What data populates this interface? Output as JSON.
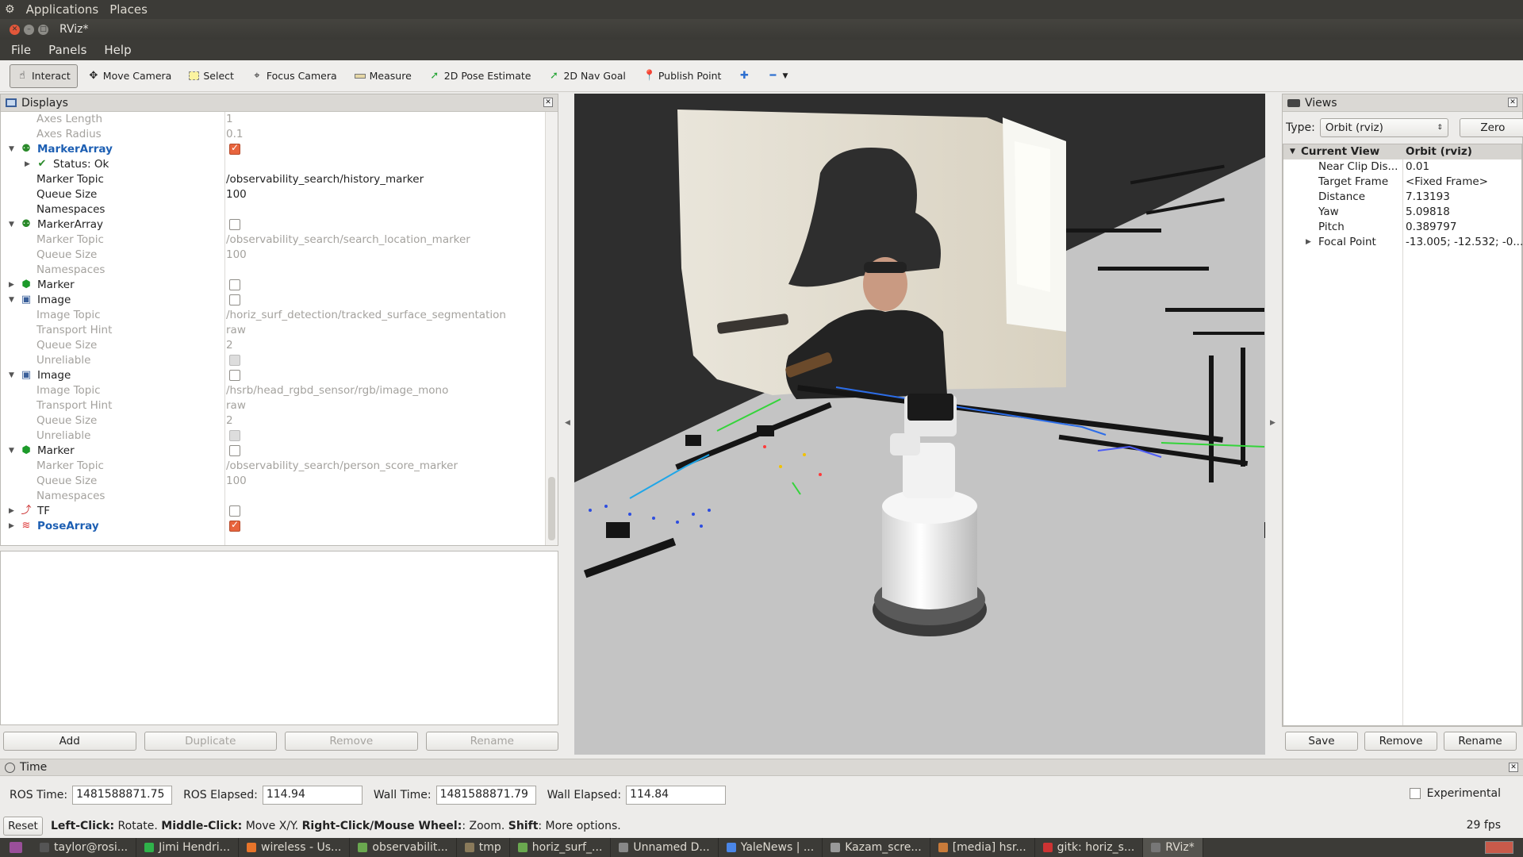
{
  "system_bar": {
    "applications": "Applications",
    "places": "Places"
  },
  "window": {
    "title": "RViz*"
  },
  "menu": [
    "File",
    "Panels",
    "Help"
  ],
  "toolbar": [
    {
      "label": "Interact",
      "icon": "cursor-icon",
      "active": true
    },
    {
      "label": "Move Camera",
      "icon": "move-camera-icon"
    },
    {
      "label": "Select",
      "icon": "select-icon"
    },
    {
      "label": "Focus Camera",
      "icon": "focus-camera-icon"
    },
    {
      "label": "Measure",
      "icon": "ruler-icon"
    },
    {
      "label": "2D Pose Estimate",
      "icon": "pose-estimate-icon"
    },
    {
      "label": "2D Nav Goal",
      "icon": "nav-goal-icon"
    },
    {
      "label": "Publish Point",
      "icon": "map-pin-icon"
    }
  ],
  "displays": {
    "title": "Displays",
    "rows": [
      {
        "name": "Axes Length",
        "value": "1",
        "disabled": true
      },
      {
        "name": "Axes Radius",
        "value": "0.1",
        "disabled": true
      },
      {
        "name": "MarkerArray",
        "group": true,
        "expanded": true,
        "highlight": true,
        "icon": "marker-array-icon",
        "checked": true
      },
      {
        "name": "Status: Ok",
        "status": true,
        "collapsed": true
      },
      {
        "name": "Marker Topic",
        "value": "/observability_search/history_marker"
      },
      {
        "name": "Queue Size",
        "value": "100"
      },
      {
        "name": "Namespaces",
        "value": ""
      },
      {
        "name": "MarkerArray",
        "group": true,
        "expanded": true,
        "icon": "marker-array-icon",
        "checked": false
      },
      {
        "name": "Marker Topic",
        "value": "/observability_search/search_location_marker",
        "disabled": true
      },
      {
        "name": "Queue Size",
        "value": "100",
        "disabled": true
      },
      {
        "name": "Namespaces",
        "value": "",
        "disabled": true
      },
      {
        "name": "Marker",
        "group": true,
        "expanded": false,
        "icon": "marker-cube-icon",
        "checked": false
      },
      {
        "name": "Image",
        "group": true,
        "expanded": true,
        "icon": "image-icon",
        "checked": false
      },
      {
        "name": "Image Topic",
        "value": "/horiz_surf_detection/tracked_surface_segmentation",
        "disabled": true
      },
      {
        "name": "Transport Hint",
        "value": "raw",
        "disabled": true
      },
      {
        "name": "Queue Size",
        "value": "2",
        "disabled": true
      },
      {
        "name": "Unreliable",
        "value": "",
        "disabled": true,
        "greybox": true
      },
      {
        "name": "Image",
        "group": true,
        "expanded": true,
        "icon": "image-icon",
        "checked": false
      },
      {
        "name": "Image Topic",
        "value": "/hsrb/head_rgbd_sensor/rgb/image_mono",
        "disabled": true
      },
      {
        "name": "Transport Hint",
        "value": "raw",
        "disabled": true
      },
      {
        "name": "Queue Size",
        "value": "2",
        "disabled": true
      },
      {
        "name": "Unreliable",
        "value": "",
        "disabled": true,
        "greybox": true
      },
      {
        "name": "Marker",
        "group": true,
        "expanded": true,
        "icon": "marker-cube-icon",
        "checked": false
      },
      {
        "name": "Marker Topic",
        "value": "/observability_search/person_score_marker",
        "disabled": true
      },
      {
        "name": "Queue Size",
        "value": "100",
        "disabled": true
      },
      {
        "name": "Namespaces",
        "value": "",
        "disabled": true
      },
      {
        "name": "TF",
        "group": true,
        "expanded": false,
        "icon": "tf-icon",
        "checked": false
      },
      {
        "name": "PoseArray",
        "group": true,
        "expanded": false,
        "highlight": true,
        "icon": "pose-array-icon",
        "checked": true
      }
    ],
    "buttons": [
      "Add",
      "Duplicate",
      "Remove",
      "Rename"
    ]
  },
  "views": {
    "title": "Views",
    "type_label": "Type:",
    "type_value": "Orbit (rviz)",
    "zero": "Zero",
    "header": {
      "key": "Current View",
      "value": "Orbit (rviz)"
    },
    "rows": [
      {
        "k": "Near Clip Dis...",
        "v": "0.01"
      },
      {
        "k": "Target Frame",
        "v": "<Fixed Frame>"
      },
      {
        "k": "Distance",
        "v": "7.13193"
      },
      {
        "k": "Yaw",
        "v": "5.09818"
      },
      {
        "k": "Pitch",
        "v": "0.389797"
      },
      {
        "k": "Focal Point",
        "v": "-13.005; -12.532; -0....",
        "expandable": true
      }
    ],
    "buttons": [
      "Save",
      "Remove",
      "Rename"
    ]
  },
  "time": {
    "title": "Time",
    "ros_time_label": "ROS Time:",
    "ros_time": "1481588871.75",
    "ros_elapsed_label": "ROS Elapsed:",
    "ros_elapsed": "114.94",
    "wall_time_label": "Wall Time:",
    "wall_time": "1481588871.79",
    "wall_elapsed_label": "Wall Elapsed:",
    "wall_elapsed": "114.84",
    "experimental": "Experimental"
  },
  "status": {
    "reset": "Reset",
    "left_click": "Left-Click:",
    "left_click_text": " Rotate. ",
    "middle_click": "Middle-Click:",
    "middle_click_text": " Move X/Y. ",
    "right_click": "Right-Click/Mouse Wheel:",
    "right_click_text": ": Zoom. ",
    "shift": "Shift",
    "shift_text": ": More options.",
    "fps": "29 fps"
  },
  "taskbar": [
    {
      "label": "taylor@rosi...",
      "color": "#555"
    },
    {
      "label": "Jimi Hendri...",
      "color": "#2fb24a"
    },
    {
      "label": "wireless - Us...",
      "color": "#e8742a"
    },
    {
      "label": "observabilit...",
      "color": "#6aa84f"
    },
    {
      "label": "tmp",
      "color": "#8a7a5a"
    },
    {
      "label": "horiz_surf_...",
      "color": "#6aa84f"
    },
    {
      "label": "Unnamed D...",
      "color": "#888"
    },
    {
      "label": "YaleNews | ...",
      "color": "#4a86e8"
    },
    {
      "label": "Kazam_scre...",
      "color": "#999"
    },
    {
      "label": "[media] hsr...",
      "color": "#c97b3a"
    },
    {
      "label": "gitk: horiz_s...",
      "color": "#c33"
    },
    {
      "label": "RViz*",
      "color": "#777",
      "active": true
    }
  ]
}
